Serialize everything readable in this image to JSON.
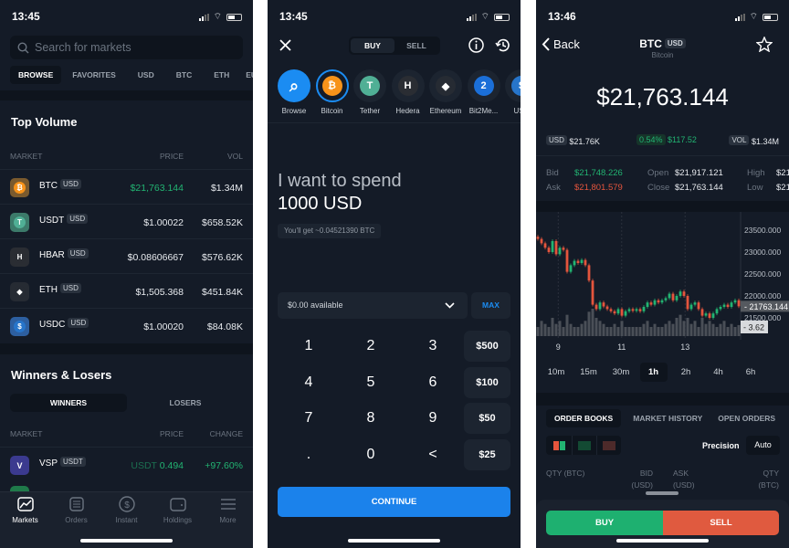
{
  "colors": {
    "bg": "#141b27",
    "green": "#22b472",
    "red": "#e4553d",
    "blue": "#1b8cf2"
  },
  "markets": {
    "status": {
      "time": "13:45"
    },
    "search_placeholder": "Search for markets",
    "tabs": [
      "BROWSE",
      "FAVORITES",
      "USD",
      "BTC",
      "ETH",
      "EU"
    ],
    "top_volume": {
      "title": "Top Volume",
      "headers": [
        "MARKET",
        "PRICE",
        "VOL"
      ],
      "rows": [
        {
          "icon": "bitcoin-icon",
          "symbol": "BTC",
          "quote": "USD",
          "price": "$21,763.144",
          "vol": "$1.34M"
        },
        {
          "icon": "tether-icon",
          "symbol": "USDT",
          "quote": "USD",
          "price": "$1.00022",
          "vol": "$658.52K"
        },
        {
          "icon": "hedera-icon",
          "symbol": "HBAR",
          "quote": "USD",
          "price": "$0.08606667",
          "vol": "$576.62K"
        },
        {
          "icon": "ethereum-icon",
          "symbol": "ETH",
          "quote": "USD",
          "price": "$1,505.368",
          "vol": "$451.84K"
        },
        {
          "icon": "usdc-icon",
          "symbol": "USDC",
          "quote": "USD",
          "price": "$1.00020",
          "vol": "$84.08K"
        }
      ]
    },
    "winners": {
      "title": "Winners & Losers",
      "segments": [
        "WINNERS",
        "LOSERS"
      ],
      "headers": [
        "MARKET",
        "PRICE",
        "CHANGE"
      ],
      "rows": [
        {
          "symbol": "VSP",
          "quote": "USDT",
          "price_unit": "USDT",
          "price": "0.494",
          "change": "+97.60%"
        }
      ]
    },
    "nav": [
      "Markets",
      "Orders",
      "Instant",
      "Holdings",
      "More"
    ]
  },
  "instant": {
    "status": {
      "time": "13:45"
    },
    "segments": [
      "BUY",
      "SELL"
    ],
    "coins": [
      {
        "label": "Browse",
        "icon": "search-icon"
      },
      {
        "label": "Bitcoin",
        "icon": "bitcoin-icon"
      },
      {
        "label": "Tether",
        "icon": "tether-icon"
      },
      {
        "label": "Hedera",
        "icon": "hedera-icon"
      },
      {
        "label": "Ethereum",
        "icon": "ethereum-icon"
      },
      {
        "label": "Bit2Me...",
        "icon": "bit2me-icon"
      },
      {
        "label": "USD",
        "icon": "usdc-icon"
      }
    ],
    "spend_label": "I want to spend",
    "amount": "1000 USD",
    "estimate": "You'll get ~0.04521390 BTC",
    "available": "$0.00 available",
    "max": "MAX",
    "keys": [
      "1",
      "2",
      "3",
      "4",
      "5",
      "6",
      "7",
      "8",
      "9",
      ".",
      "0",
      "<"
    ],
    "quick": [
      "$500",
      "$100",
      "$50",
      "$25"
    ],
    "continue": "CONTINUE"
  },
  "detail": {
    "status": {
      "time": "13:46"
    },
    "back": "Back",
    "symbol": "BTC",
    "quote": "USD",
    "name": "Bitcoin",
    "price": "$21,763.144",
    "stats": {
      "usd_tag": "USD",
      "usd": "$21.76K",
      "change_pct": "0.54%",
      "change": "$117.52",
      "vol_tag": "VOL",
      "vol": "$1.34M"
    },
    "ohlc": {
      "bid_label": "Bid",
      "bid": "$21,748.226",
      "ask_label": "Ask",
      "ask": "$21,801.579",
      "open_label": "Open",
      "open": "$21,917.121",
      "close_label": "Close",
      "close": "$21,763.144",
      "high_label": "High",
      "high": "$21",
      "low_label": "Low",
      "low": "$21"
    },
    "timeframes": [
      "10m",
      "15m",
      "30m",
      "1h",
      "2h",
      "4h",
      "6h"
    ],
    "active_timeframe": "1h",
    "tabs": [
      "ORDER BOOKS",
      "MARKET HISTORY",
      "OPEN ORDERS"
    ],
    "precision_label": "Precision",
    "precision": "Auto",
    "book_headers": [
      "QTY (BTC)",
      "BID (USD)",
      "ASK (USD)",
      "QTY (BTC)"
    ],
    "buy": "BUY",
    "sell": "SELL"
  },
  "chart_data": {
    "type": "candlestick",
    "y_ticks": [
      "23500.000",
      "23000.000",
      "22500.000",
      "22000.000",
      "21500.000"
    ],
    "x_ticks": [
      "9",
      "11",
      "13"
    ],
    "ylim": [
      21100,
      23700
    ],
    "xlim": [
      8.3,
      14.75
    ],
    "last_price_label": "21763.144",
    "last_volume_label": "3.62",
    "close": [
      23300,
      23200,
      23100,
      23000,
      23250,
      22950,
      23100,
      23050,
      22550,
      22700,
      22800,
      22750,
      22820,
      22700,
      22350,
      21800,
      21700,
      21850,
      21760,
      21700,
      21650,
      21600,
      21700,
      21550,
      21650,
      21700,
      21660,
      21700,
      21650,
      21750,
      21850,
      21800,
      21900,
      21850,
      21900,
      21950,
      22050,
      21900,
      22000,
      22100,
      22000,
      21700,
      21800,
      21850,
      21700,
      21550,
      21600,
      21500,
      21600,
      21700,
      21750,
      21800,
      21750,
      21850,
      21900,
      21763.144
    ],
    "volume": [
      3,
      5,
      4,
      3,
      6,
      4,
      5,
      3,
      7,
      4,
      3,
      3,
      4,
      5,
      8,
      9,
      6,
      5,
      4,
      3,
      3,
      4,
      3,
      5,
      3,
      3,
      3,
      3,
      3,
      4,
      5,
      3,
      4,
      3,
      3,
      4,
      5,
      4,
      6,
      7,
      5,
      6,
      4,
      5,
      3,
      6,
      4,
      5,
      4,
      3,
      4,
      5,
      3,
      4,
      3,
      3.62
    ]
  }
}
